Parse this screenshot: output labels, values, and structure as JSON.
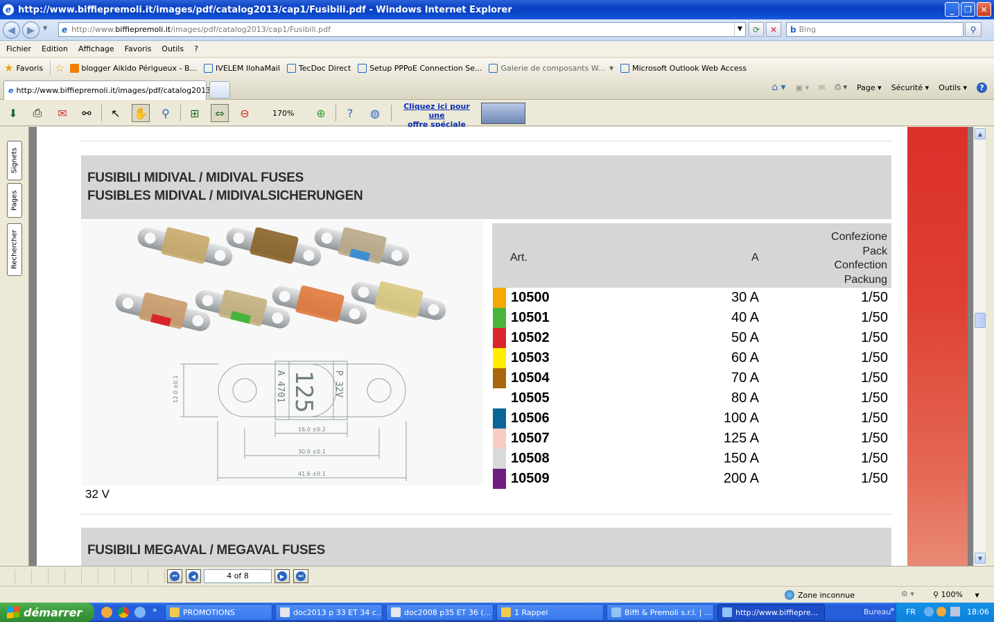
{
  "window": {
    "title": "http://www.biffiepremoli.it/images/pdf/catalog2013/cap1/Fusibili.pdf - Windows Internet Explorer"
  },
  "address": {
    "url_prefix": "http://www.",
    "url_domain": "biffiepremoli.it",
    "url_path": "/images/pdf/catalog2013/cap1/Fusibili.pdf",
    "search_placeholder": "Bing"
  },
  "menu": [
    "Fichier",
    "Edition",
    "Affichage",
    "Favoris",
    "Outils",
    "?"
  ],
  "favorites": {
    "label": "Favoris",
    "items": [
      {
        "label": "blogger Aikido Périgueux - B...",
        "icon": "blogger-icon",
        "color": "#F57D00"
      },
      {
        "label": "IVELEM IlohaMail",
        "icon": "ie-page-icon",
        "color": "#1F66D0"
      },
      {
        "label": "TecDoc Direct",
        "icon": "ie-page-icon",
        "color": "#1F66D0"
      },
      {
        "label": "Setup PPPoE Connection Se...",
        "icon": "ie-page-icon",
        "color": "#1F66D0"
      },
      {
        "label": "Galerie de composants W...",
        "icon": "ie-page-icon",
        "color": "#1F66D0"
      },
      {
        "label": "Microsoft Outlook Web Access",
        "icon": "ie-page-icon",
        "color": "#1F66D0"
      }
    ]
  },
  "tab": {
    "label": "http://www.biffiepremoli.it/images/pdf/catalog2013/c..."
  },
  "command_bar": {
    "page": "Page",
    "security": "Sécurité",
    "tools": "Outils"
  },
  "pdf_toolbar": {
    "zoom": "170%",
    "promo_line1": "Cliquez ici pour une",
    "promo_line2": "offre spéciale"
  },
  "side_tabs": [
    "Signets",
    "Pages",
    "Rechercher"
  ],
  "document": {
    "section1": {
      "title_line1": "FUSIBILI MIDIVAL / MIDIVAL FUSES",
      "title_line2": "FUSIBLES MIDIVAL / MIDIVALSICHERUNGEN"
    },
    "drawing": {
      "dim_height": "12.0 ±0.1",
      "dim_inner": "16.0 ±0.2",
      "dim_mid": "30.0 ±0.1",
      "dim_outer": "41.6 ±0.1",
      "fuse_text_left": "A 4701",
      "fuse_text_mid": "125",
      "fuse_text_right": "P 32V"
    },
    "voltage": "32 V",
    "table": {
      "col_art": "Art.",
      "col_a": "A",
      "col_pack": [
        "Confezione",
        "Pack",
        "Confection",
        "Packung"
      ],
      "rows": [
        {
          "art": "10500",
          "amp": "30 A",
          "pack": "1/50",
          "color": "#F5A800"
        },
        {
          "art": "10501",
          "amp": "40 A",
          "pack": "1/50",
          "color": "#47B539"
        },
        {
          "art": "10502",
          "amp": "50 A",
          "pack": "1/50",
          "color": "#D9262B"
        },
        {
          "art": "10503",
          "amp": "60 A",
          "pack": "1/50",
          "color": "#FFEC00"
        },
        {
          "art": "10504",
          "amp": "70 A",
          "pack": "1/50",
          "color": "#A8670C"
        },
        {
          "art": "10505",
          "amp": "80 A",
          "pack": "1/50",
          "color": "#FFFFFF"
        },
        {
          "art": "10506",
          "amp": "100 A",
          "pack": "1/50",
          "color": "#0A6598"
        },
        {
          "art": "10507",
          "amp": "125 A",
          "pack": "1/50",
          "color": "#F7CCC2"
        },
        {
          "art": "10508",
          "amp": "150 A",
          "pack": "1/50",
          "color": "#D9D9D9"
        },
        {
          "art": "10509",
          "amp": "200 A",
          "pack": "1/50",
          "color": "#6E1F7E"
        }
      ]
    },
    "section2": {
      "title_line1": "FUSIBILI MEGAVAL / MEGAVAL FUSES"
    }
  },
  "pdf_nav": {
    "page_indicator": "4 of 8"
  },
  "status": {
    "zone": "Zone inconnue",
    "zoom": "100%"
  },
  "taskbar": {
    "start": "démarrer",
    "tasks": [
      {
        "label": "PROMOTIONS",
        "color": "#F2C94C"
      },
      {
        "label": "doc2013 p 33 ET 34 c...",
        "color": "#E6E6E6"
      },
      {
        "label": "doc2008 p35 ET 36  (...",
        "color": "#E6E6E6"
      },
      {
        "label": "1 Rappel",
        "color": "#F2C94C"
      },
      {
        "label": "Biffi & Premoli s.r.l. | ...",
        "color": "#8FC3F5"
      },
      {
        "label": "http://www.biffiepre...",
        "color": "#8FC3F5"
      }
    ],
    "bureau": "Bureau",
    "lang": "FR",
    "clock": "18:06"
  }
}
